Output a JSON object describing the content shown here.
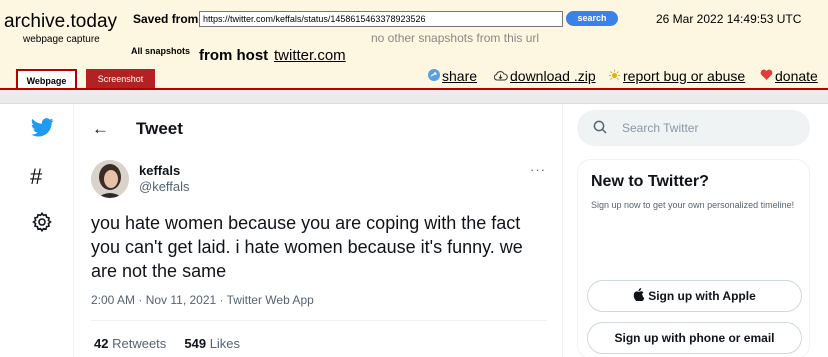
{
  "archive": {
    "title": "archive.today",
    "subtitle": "webpage capture",
    "saved_from_label": "Saved from",
    "url_value": "https://twitter.com/keffals/status/1458615463378923526",
    "search_label": "search",
    "capture_date": "26 Mar 2022 14:49:53 UTC",
    "no_snapshots_text": "no other snapshots from this url",
    "all_snapshots_label": "All snapshots",
    "from_host_label": "from host",
    "host_link": "twitter.com",
    "tabs": [
      {
        "label": "Webpage"
      },
      {
        "label": "Screenshot"
      }
    ],
    "actions": {
      "share": "share",
      "download": "download .zip",
      "report": "report bug or abuse",
      "donate": "donate"
    },
    "colors": {
      "accent_red": "#b30000",
      "search_blue": "#3b82e8",
      "header_bg": "#fdf7e2"
    }
  },
  "twitter": {
    "nav_icons": [
      "twitter-logo-icon",
      "hashtag-icon",
      "gear-icon"
    ],
    "explore_glyph": "#",
    "back_glyph": "←",
    "heading": "Tweet",
    "author": {
      "name": "keffals",
      "handle": "@keffals"
    },
    "more_glyph": "···",
    "text": "you hate women because you are coping with the fact you can't get laid. i hate women because it's funny. we are not the same",
    "meta": "2:00 AM · Nov 11, 2021 · Twitter Web App",
    "stats": {
      "retweets_count": "42",
      "retweets_label": "Retweets",
      "likes_count": "549",
      "likes_label": "Likes"
    },
    "search_placeholder": "Search Twitter",
    "new_panel": {
      "title": "New to Twitter?",
      "description": "Sign up now to get your own personalized timeline!",
      "apple_button": "Sign up with Apple",
      "phone_button": "Sign up with phone or email"
    },
    "colors": {
      "brand_blue": "#1d9bf0",
      "text": "#0f1419",
      "secondary": "#536471"
    }
  }
}
